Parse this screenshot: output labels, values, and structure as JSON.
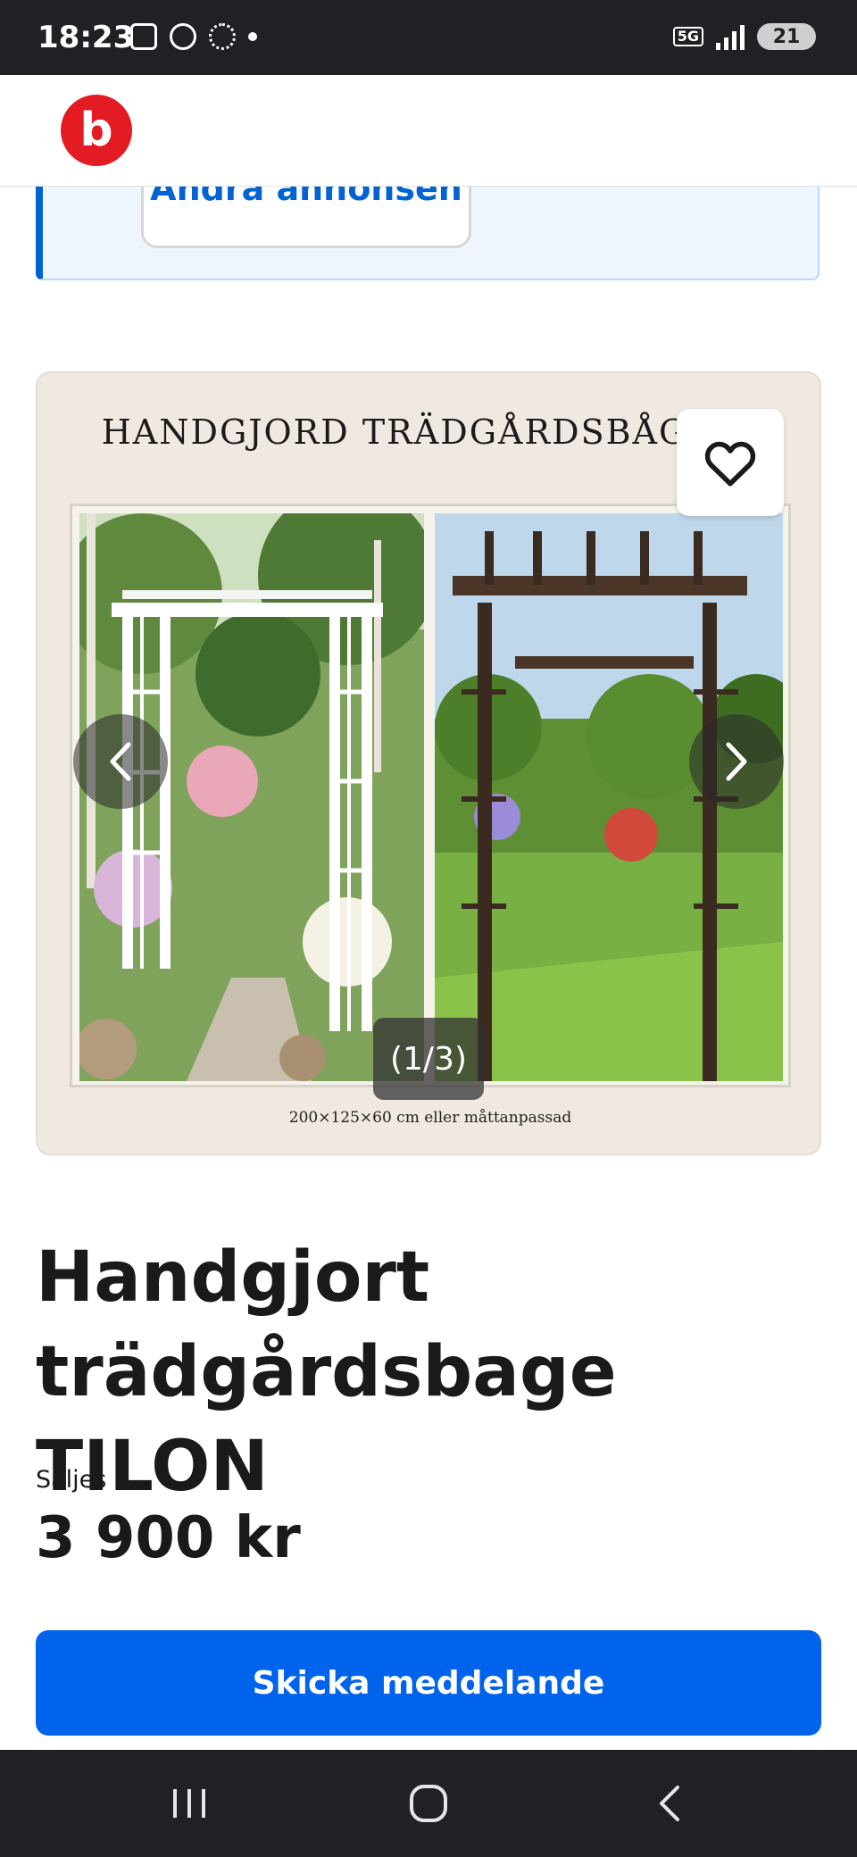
{
  "status_bar": {
    "time": "18:23",
    "network": "5G",
    "battery": "21"
  },
  "header": {
    "logo_letter": "b",
    "brand_color": "#e31b23"
  },
  "info_box": {
    "edit_button_label": "Ändra annonsen"
  },
  "gallery": {
    "image_title": "HANDGJORD TRÄDGÅRDSBÅG",
    "image_caption": "200×125×60 cm eller måttanpassad",
    "counter": "(1/3)",
    "favorite_icon": "heart-icon",
    "prev_icon": "chevron-left-icon",
    "next_icon": "chevron-right-icon"
  },
  "listing": {
    "title": "Handgjort trädgårdsbage TILON",
    "sale_type": "Säljes",
    "price": "3 900 kr"
  },
  "actions": {
    "send_message_label": "Skicka meddelande",
    "accent_color": "#0063eb"
  },
  "nav_bar": {
    "recents_icon": "recents-icon",
    "home_icon": "home-icon",
    "back_icon": "back-icon"
  }
}
